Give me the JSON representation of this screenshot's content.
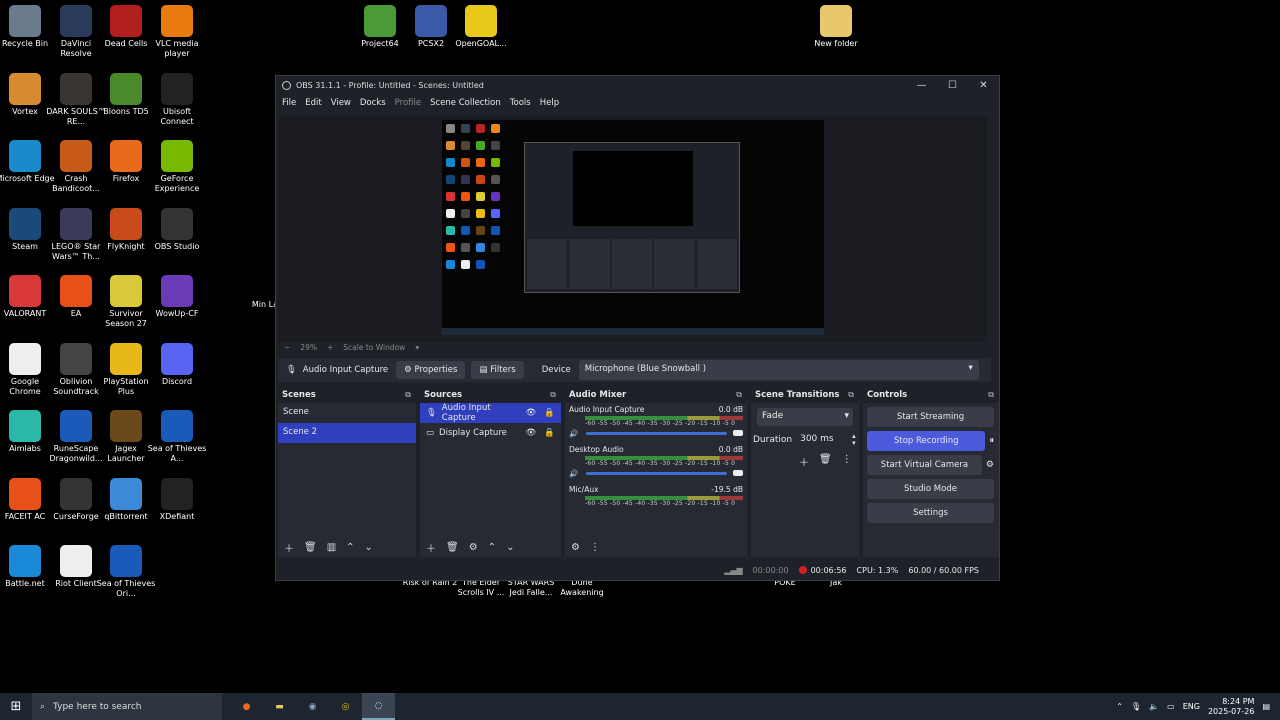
{
  "desktop": {
    "icons": [
      {
        "label": "Recycle Bin",
        "icon": "recycle-bin-icon",
        "color": "#6b7b8c"
      },
      {
        "label": "DaVinci Resolve",
        "icon": "davinci-icon",
        "color": "#2a3a5a"
      },
      {
        "label": "Dead Cells",
        "icon": "dead-cells-icon",
        "color": "#b01e1e"
      },
      {
        "label": "VLC media player",
        "icon": "vlc-icon",
        "color": "#e87a10"
      },
      {
        "label": "Vortex",
        "icon": "vortex-icon",
        "color": "#d88a30"
      },
      {
        "label": "DARK SOULS™ RE...",
        "icon": "dark-souls-icon",
        "color": "#3a3530"
      },
      {
        "label": "Bloons TD5",
        "icon": "bloons-icon",
        "color": "#4a8a2a"
      },
      {
        "label": "Ubisoft Connect",
        "icon": "ubisoft-icon",
        "color": "#222"
      },
      {
        "label": "Microsoft Edge",
        "icon": "edge-icon",
        "color": "#1a8acb"
      },
      {
        "label": "Crash Bandicoot...",
        "icon": "crash-icon",
        "color": "#c85a1a"
      },
      {
        "label": "Firefox",
        "icon": "firefox-icon",
        "color": "#e86a1a"
      },
      {
        "label": "GeForce Experience",
        "icon": "geforce-icon",
        "color": "#76b900"
      },
      {
        "label": "Steam",
        "icon": "steam-icon",
        "color": "#1b4a7a"
      },
      {
        "label": "LEGO® Star Wars™ Th...",
        "icon": "lego-icon",
        "color": "#3a3a5a"
      },
      {
        "label": "FlyKnight",
        "icon": "flyknight-icon",
        "color": "#c84a1a"
      },
      {
        "label": "OBS Studio",
        "icon": "obs-icon",
        "color": "#333"
      },
      {
        "label": "VALORANT",
        "icon": "valorant-icon",
        "color": "#d8383a"
      },
      {
        "label": "EA",
        "icon": "ea-icon",
        "color": "#e8501a"
      },
      {
        "label": "Survivor Season 27",
        "icon": "survivor-icon",
        "color": "#d8c83a"
      },
      {
        "label": "WowUp-CF",
        "icon": "wowup-icon",
        "color": "#6a3ab8"
      },
      {
        "label": "Google Chrome",
        "icon": "chrome-file-icon",
        "color": "#eee"
      },
      {
        "label": "Oblivion Soundtrack",
        "icon": "oblivion-icon",
        "color": "#444"
      },
      {
        "label": "PlayStation Plus",
        "icon": "psplus-icon",
        "color": "#e8b81a"
      },
      {
        "label": "Discord",
        "icon": "discord-icon",
        "color": "#5865f2"
      },
      {
        "label": "Aimlabs",
        "icon": "aimlabs-icon",
        "color": "#2ab8a8"
      },
      {
        "label": "RuneScape Dragonwild...",
        "icon": "runescape-icon",
        "color": "#1a5ab8"
      },
      {
        "label": "Jagex Launcher",
        "icon": "jagex-icon",
        "color": "#6a4a1a"
      },
      {
        "label": "Sea of Thieves A...",
        "icon": "sea-of-thieves-icon",
        "color": "#1a5ab8"
      },
      {
        "label": "FACEIT AC",
        "icon": "faceit-icon",
        "color": "#e8501a"
      },
      {
        "label": "CurseForge",
        "icon": "curseforge-icon",
        "color": "#333"
      },
      {
        "label": "qBittorrent",
        "icon": "qbittorrent-icon",
        "color": "#3a8ad8"
      },
      {
        "label": "XDefiant",
        "icon": "xdefiant-icon",
        "color": "#222"
      },
      {
        "label": "Battle.net",
        "icon": "battlenet-icon",
        "color": "#1a8ad8"
      },
      {
        "label": "Riot Client",
        "icon": "riot-file-icon",
        "color": "#eee"
      },
      {
        "label": "Sea of Thieves Ori...",
        "icon": "sea-of-thieves-icon",
        "color": "#1a5ab8"
      },
      {
        "label": "Project64",
        "icon": "project64-icon",
        "color": "#4a9a3a"
      },
      {
        "label": "PCSX2",
        "icon": "pcsx2-icon",
        "color": "#3a5aa8"
      },
      {
        "label": "OpenGOAL...",
        "icon": "opengoal-icon",
        "color": "#e8c81a"
      },
      {
        "label": "New folder",
        "icon": "folder-icon",
        "color": "#e8c86a"
      }
    ],
    "partial_labels": [
      "Risk of Rain 2",
      "The Elder Scrolls IV ...",
      "STAR WARS Jedi Falle...",
      "Dune Awakening",
      "POKE",
      "Jak",
      "Min Lau"
    ]
  },
  "obs": {
    "title": "OBS 31.1.1 - Profile: Untitled - Scenes: Untitled",
    "menu": [
      "File",
      "Edit",
      "View",
      "Docks",
      "Profile",
      "Scene Collection",
      "Tools",
      "Help"
    ],
    "zoom": "29%",
    "scale_mode": "Scale to Window",
    "source_bar": {
      "source_name": "Audio Input Capture",
      "properties": "Properties",
      "filters": "Filters",
      "device_label": "Device",
      "device_value": "Microphone (Blue Snowball )"
    },
    "scenes": {
      "title": "Scenes",
      "items": [
        "Scene",
        "Scene 2"
      ],
      "selected": "Scene 2"
    },
    "sources": {
      "title": "Sources",
      "items": [
        "Audio Input Capture",
        "Display Capture"
      ]
    },
    "mixer": {
      "title": "Audio Mixer",
      "ticks": "-60 -55 -50 -45 -40 -35 -30 -25 -20 -15 -10 -5 0",
      "channels": [
        {
          "name": "Audio Input Capture",
          "db": "0.0 dB"
        },
        {
          "name": "Desktop Audio",
          "db": "0.0 dB"
        },
        {
          "name": "Mic/Aux",
          "db": "-19.5 dB"
        }
      ]
    },
    "transitions": {
      "title": "Scene Transitions",
      "type": "Fade",
      "duration_label": "Duration",
      "duration_value": "300 ms"
    },
    "controls": {
      "title": "Controls",
      "start_streaming": "Start Streaming",
      "stop_recording": "Stop Recording",
      "start_virtual_camera": "Start Virtual Camera",
      "studio_mode": "Studio Mode",
      "settings": "Settings"
    },
    "status": {
      "stream_time": "00:00:00",
      "rec_time": "00:06:56",
      "cpu": "CPU: 1.3%",
      "fps": "60.00 / 60.00 FPS"
    }
  },
  "taskbar": {
    "search_placeholder": "Type here to search",
    "lang": "ENG",
    "time": "8:24 PM",
    "date": "2025-07-26"
  }
}
